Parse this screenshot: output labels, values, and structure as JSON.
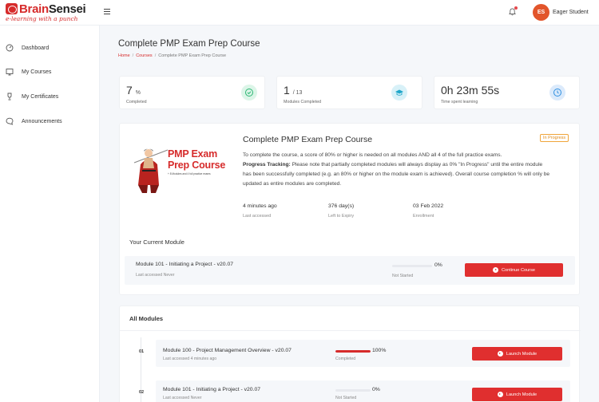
{
  "brand": {
    "name_part1": "Brain",
    "name_part2": "Sensei",
    "tagline": "e-learning with a punch"
  },
  "header": {
    "avatar_initials": "ES",
    "user_name": "Eager Student",
    "menu_icon": "hamburger-icon",
    "bell_icon": "bell-icon"
  },
  "sidebar": {
    "items": [
      {
        "label": "Dashboard",
        "icon": "gauge-icon"
      },
      {
        "label": "My Courses",
        "icon": "courses-icon"
      },
      {
        "label": "My Certificates",
        "icon": "trophy-icon"
      },
      {
        "label": "Announcements",
        "icon": "chat-icon"
      }
    ]
  },
  "page": {
    "title": "Complete PMP Exam Prep Course",
    "breadcrumb": [
      "Home",
      "Courses",
      "Complete PMP Exam Prep Course"
    ]
  },
  "stats": [
    {
      "value": "7",
      "unit": "%",
      "label": "Completed",
      "icon": "check-circle-icon",
      "color": "#2bb673"
    },
    {
      "value": "1",
      "unit": "/ 13",
      "label": "Modules Completed",
      "icon": "graduation-cap-icon",
      "color": "#1fa6c9"
    },
    {
      "value": "0h 23m 55s",
      "label": "Time spent learning",
      "icon": "clock-icon",
      "color": "#2f8fe0"
    }
  ],
  "course": {
    "image_title_line1": "PMP Exam",
    "image_title_line2": "Prep Course",
    "image_subtitle": "+ 8 Modules and 4 full practice exams",
    "title": "Complete PMP Exam Prep Course",
    "status_badge": "In Progress",
    "description_line1": "To complete the course, a score of 80% or higher is needed on all modules AND all 4 of the full practice exams.",
    "progress_tracking_label": "Progress Tracking:",
    "progress_tracking_text1": " Please note that partially completed modules will always display as 0% \"In Progress\" until the entire module",
    "progress_tracking_text2": "has been successfully completed (e.g. an 80% or higher on the module exam is achieved). Overall course completion % will only be",
    "progress_tracking_text3": "updated as entire modules are completed.",
    "meta": [
      {
        "value": "4 minutes ago",
        "label": "Last accessed"
      },
      {
        "value": "376 day(s)",
        "label": "Left to Expiry"
      },
      {
        "value": "03 Feb 2022",
        "label": "Enrollment"
      }
    ],
    "current_module_heading": "Your Current Module",
    "current_module": {
      "name": "Module 101 - Initiating a Project - v20.07",
      "last_accessed": "Last accessed Never",
      "progress": 0,
      "percent_label": "0%",
      "status": "Not Started",
      "button": "Continue Course"
    }
  },
  "all_modules": {
    "heading": "All Modules",
    "items": [
      {
        "number": "01",
        "name": "Module 100 - Project Management Overview - v20.07",
        "last_accessed": "Last accessed 4 minutes ago",
        "progress": 1.0,
        "percent_label": "100%",
        "status": "Completed",
        "button": "Launch Module"
      },
      {
        "number": "02",
        "name": "Module 101 - Initiating a Project - v20.07",
        "last_accessed": "Last accessed Never",
        "progress": 0,
        "percent_label": "0%",
        "status": "Not Started",
        "button": "Launch Module"
      }
    ]
  }
}
